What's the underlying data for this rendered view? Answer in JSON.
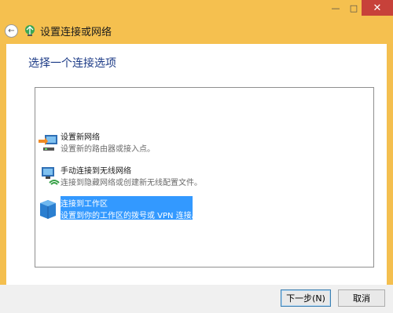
{
  "window": {
    "title": "设置连接或网络",
    "controls": {
      "minimize": "—",
      "maximize": "□",
      "close": "✕"
    },
    "back_icon": "←"
  },
  "main": {
    "heading": "选择一个连接选项",
    "options": [
      {
        "label": "设置新网络",
        "description": "设置新的路由器或接入点。",
        "icon": "router-icon",
        "selected": false
      },
      {
        "label": "手动连接到无线网络",
        "description": "连接到隐藏网络或创建新无线配置文件。",
        "icon": "wireless-network-icon",
        "selected": false
      },
      {
        "label": "连接到工作区",
        "description": "设置到你的工作区的拨号或 VPN 连接。",
        "icon": "workplace-icon",
        "selected": true
      }
    ]
  },
  "footer": {
    "next_label": "下一步(N)",
    "cancel_label": "取消"
  },
  "colors": {
    "frame": "#f4bf4f",
    "heading": "#1b3a86",
    "selection": "#3399ff",
    "close": "#c7413a"
  }
}
